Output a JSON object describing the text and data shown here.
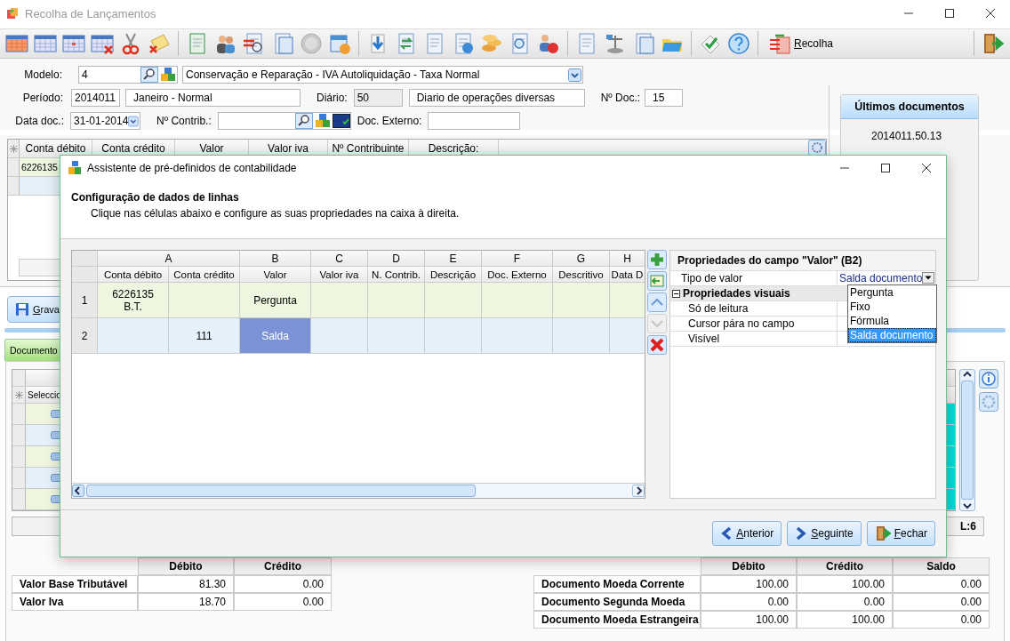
{
  "window": {
    "title": "Recolha de Lançamentos"
  },
  "toolbar": {
    "recolha_button": "Recolha"
  },
  "form": {
    "modelo": {
      "label": "Modelo:",
      "value": "4",
      "description": "Conservação e Reparação - IVA Autoliquidação - Taxa Normal"
    },
    "periodo": {
      "label": "Período:",
      "value": "2014011",
      "description": "Janeiro - Normal"
    },
    "diario": {
      "label": "Diário:",
      "value": "50",
      "description": "Diario de operações diversas"
    },
    "numero_documento": {
      "label": "Nº Doc.:",
      "value": "15"
    },
    "data_documento": {
      "label": "Data doc.:",
      "value": "31-01-2014"
    },
    "numero_contribuinte": {
      "label": "Nº Contrib.:"
    },
    "documento_externo": {
      "label": "Doc. Externo:"
    }
  },
  "lines_grid": {
    "columns": [
      "Conta débito",
      "Conta crédito",
      "Valor",
      "Valor iva",
      "Nº Contribuinte",
      "Descrição:"
    ],
    "rows": [
      {
        "conta_debito": "6226135"
      }
    ]
  },
  "recent_documents": {
    "title": "Últimos documentos",
    "items": [
      "2014011.50.13"
    ]
  },
  "save_button": "Grava",
  "tabs": [
    {
      "label": "Documento",
      "selected": true
    }
  ],
  "document_grid": {
    "column": "Seleccio"
  },
  "status_bar": {
    "lines": "L:6"
  },
  "tax_totals": {
    "columns": [
      "Débito",
      "Crédito"
    ],
    "rows": [
      {
        "label": "Valor Base Tributável",
        "values": [
          "81.30",
          "0.00"
        ]
      },
      {
        "label": "Valor Iva",
        "values": [
          "18.70",
          "0.00"
        ]
      }
    ]
  },
  "document_totals": {
    "columns": [
      "Débito",
      "Crédito",
      "Saldo"
    ],
    "rows": [
      {
        "label": "Documento Moeda Corrente",
        "values": [
          "100.00",
          "100.00",
          "0.00"
        ]
      },
      {
        "label": "Documento Segunda Moeda",
        "values": [
          "0.00",
          "0.00",
          "0.00"
        ]
      },
      {
        "label": "Documento Moeda Estrangeira",
        "values": [
          "100.00",
          "100.00",
          "0.00"
        ]
      }
    ]
  },
  "dialog": {
    "title": "Assistente de pré-definidos de contabilidade",
    "heading": "Configuração de dados de linhas",
    "instruction": "Clique nas células abaixo e configure as suas propriedades na caixa à direita.",
    "grid": {
      "columns": [
        {
          "letter": "A",
          "name": "Conta débito"
        },
        {
          "name": "Conta crédito"
        },
        {
          "letter": "B",
          "name": "Valor"
        },
        {
          "letter": "C",
          "name": "Valor iva"
        },
        {
          "letter": "D",
          "name": "N. Contrib."
        },
        {
          "letter": "E",
          "name": "Descrição"
        },
        {
          "letter": "F",
          "name": "Doc. Externo"
        },
        {
          "letter": "G",
          "name": "Descritivo"
        },
        {
          "letter": "H",
          "name": "Data D"
        }
      ],
      "rows": [
        {
          "number": "1",
          "cells": [
            {
              "text": "6226135\nB.T.",
              "selected": false
            },
            {
              "selected": false
            },
            {
              "text": "Pergunta",
              "selected": false
            },
            {
              "selected": false
            },
            {
              "selected": false
            },
            {
              "selected": false
            },
            {
              "selected": false
            },
            {
              "selected": false
            },
            {
              "selected": false
            }
          ]
        },
        {
          "number": "2",
          "cells": [
            {
              "selected": false
            },
            {
              "text": "111",
              "selected": false
            },
            {
              "text": "Salda",
              "selected": true
            },
            {
              "selected": false
            },
            {
              "selected": false
            },
            {
              "selected": false
            },
            {
              "selected": false
            },
            {
              "selected": false
            },
            {
              "selected": false
            }
          ]
        }
      ]
    },
    "side_buttons": [
      {
        "kind": "add",
        "disabled": false
      },
      {
        "kind": "insert",
        "disabled": false
      },
      {
        "kind": "up",
        "disabled": false
      },
      {
        "kind": "down",
        "disabled": true
      },
      {
        "kind": "delete",
        "disabled": false
      }
    ],
    "properties": {
      "title": "Propriedades do campo \"Valor\" (B2)",
      "rows": [
        {
          "kind": "field",
          "label": "Tipo de valor",
          "value": "Salda documento"
        },
        {
          "kind": "group",
          "label": "Propriedades visuais",
          "expanded": true,
          "children": [
            {
              "label": "Só de leitura"
            },
            {
              "label": "Cursor pára no campo"
            },
            {
              "label": "Visível"
            }
          ]
        }
      ],
      "dropdown": {
        "options": [
          {
            "label": "Pergunta",
            "selected": false
          },
          {
            "label": "Fixo",
            "selected": false
          },
          {
            "label": "Fórmula",
            "selected": false
          },
          {
            "label": "Salda documento",
            "selected": true
          }
        ]
      }
    },
    "buttons": [
      {
        "kind": "back",
        "label": "Anterior"
      },
      {
        "kind": "next",
        "label": "Seguinte"
      },
      {
        "kind": "close",
        "label": "Fechar"
      }
    ]
  }
}
